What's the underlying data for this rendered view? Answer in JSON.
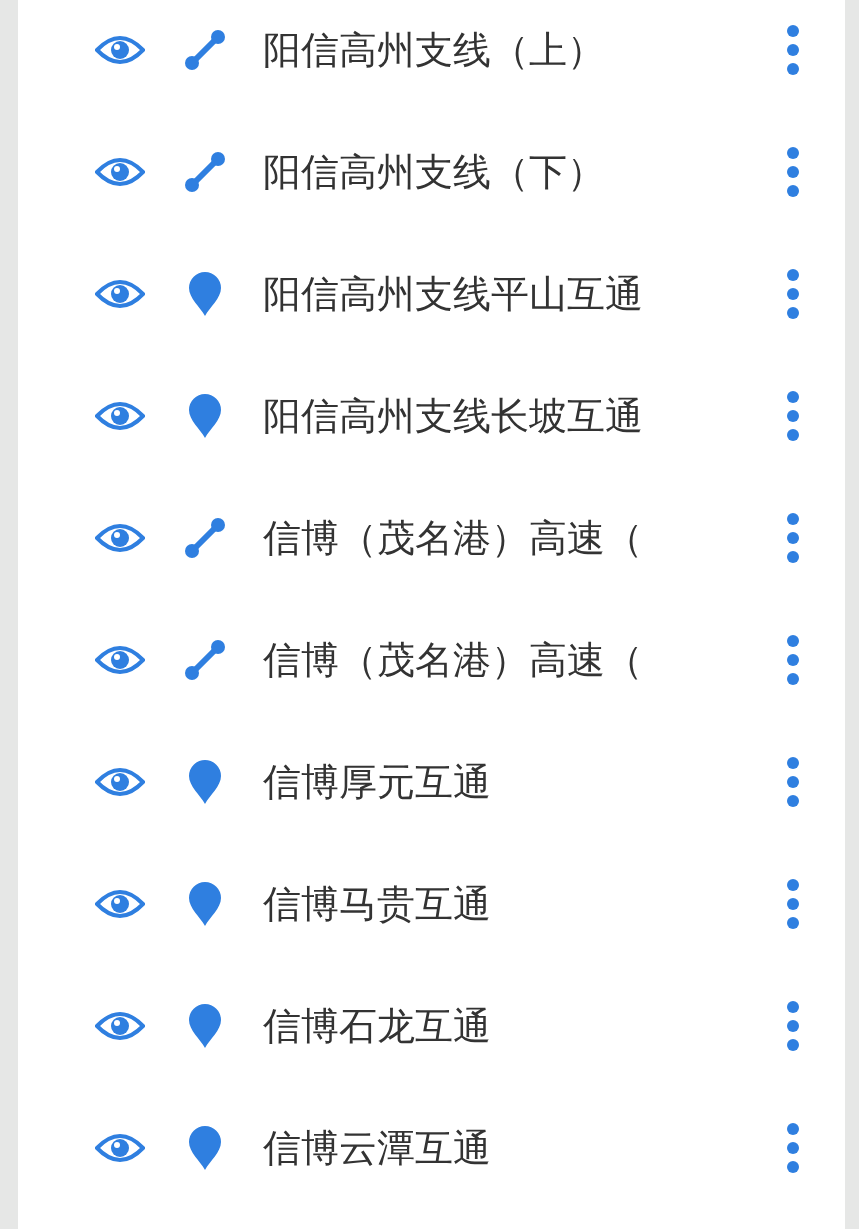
{
  "layers": [
    {
      "kind": "route",
      "name": "阳信高州支线（上）",
      "visible": true
    },
    {
      "kind": "route",
      "name": "阳信高州支线（下）",
      "visible": true
    },
    {
      "kind": "point",
      "name": "阳信高州支线平山互通",
      "visible": true
    },
    {
      "kind": "point",
      "name": "阳信高州支线长坡互通",
      "visible": true
    },
    {
      "kind": "route",
      "name": "信博（茂名港）高速（",
      "visible": true
    },
    {
      "kind": "route",
      "name": "信博（茂名港）高速（",
      "visible": true
    },
    {
      "kind": "point",
      "name": "信博厚元互通",
      "visible": true
    },
    {
      "kind": "point",
      "name": "信博马贵互通",
      "visible": true
    },
    {
      "kind": "point",
      "name": "信博石龙互通",
      "visible": true
    },
    {
      "kind": "point",
      "name": "信博云潭互通",
      "visible": true
    }
  ]
}
